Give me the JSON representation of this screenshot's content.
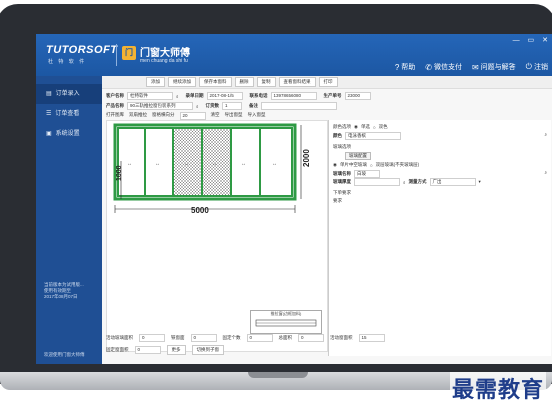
{
  "header": {
    "brand_main": "TUTORSOFT",
    "brand_sub": "杜 特 软 件",
    "product_icon": "门",
    "product_name": "门窗大师傅",
    "product_sub": "men chuang da shi fu",
    "window_controls": [
      "—",
      "▭",
      "✕"
    ],
    "links": [
      {
        "icon": "help-icon",
        "glyph": "?",
        "label": "帮助"
      },
      {
        "icon": "wechat-icon",
        "glyph": "✆",
        "label": "微信支付"
      },
      {
        "icon": "feedback-icon",
        "glyph": "✉",
        "label": "问题与解答"
      },
      {
        "icon": "logout-icon",
        "glyph": "⏻",
        "label": "注销"
      }
    ]
  },
  "sidebar": {
    "items": [
      {
        "label": "订单录入",
        "icon": "document-icon",
        "glyph": "▤",
        "active": true
      },
      {
        "label": "订单查看",
        "icon": "list-icon",
        "glyph": "☰",
        "active": false
      },
      {
        "label": "系统设置",
        "icon": "settings-icon",
        "glyph": "▣",
        "active": false
      }
    ],
    "footer_lines": [
      "当前版本为试用版...",
      "使用有效期至",
      "2017年08月07日"
    ],
    "bottom_text": "欢迎使用门窗大师傅"
  },
  "toolbar": {
    "buttons": [
      "添加",
      "继续添加",
      "保存本窗料",
      "删除",
      "复制",
      "查看窗料结果",
      "打印"
    ]
  },
  "form": {
    "customer_label": "客户名称",
    "customer_value": "杜特软件",
    "date_label": "录单日期",
    "date_value": "2017-08-1/5",
    "phone_label": "联系电话",
    "phone_value": "13978656080",
    "order_label": "生产单号",
    "order_value": "23000",
    "product_label": "产品名称",
    "product_value": "90三轨推拉窗包装系列",
    "qty_label": "订货数",
    "qty_value": "1",
    "note_label": "备注",
    "note_value": ""
  },
  "sub_toolbar": [
    "打开图库",
    "双扇推拉",
    "窗格横向分",
    "20",
    "清空",
    "导出窗型",
    "导入窗型"
  ],
  "drawing": {
    "width_label": "5000",
    "height_label": "2000",
    "sash_height_label": "1000"
  },
  "right_panel": {
    "row1_label": "颜色选项",
    "row1_opt_a": "单选",
    "row1_opt_b": "双色",
    "color_label": "颜色",
    "color_value": "电泳香槟",
    "glass_section": "玻璃选项",
    "glass_btn": "玻璃配置",
    "glass_opt_a": "单片中空玻璃",
    "glass_opt_b": "双层玻璃(不夹玻璃层)",
    "glass_name_label": "玻璃名称",
    "glass_name_value": "白玻",
    "glass_thick_label": "玻璃厚度",
    "glass_thick_value": "",
    "measure_label": "测量方式",
    "measure_value": "广出",
    "misc_label": "下单要求",
    "misc_value": "要求"
  },
  "legend_box": {
    "title": "推拉窗(边框加料)"
  },
  "bottom": {
    "row1": [
      {
        "label": "活动玻璃面积",
        "value": "0"
      },
      {
        "label": "铁窗面",
        "value": "0"
      },
      {
        "label": "固定个数",
        "value": "0"
      },
      {
        "label": "总面积",
        "value": "0"
      },
      {
        "label": "活动窗面积",
        "value": "15"
      }
    ],
    "row2_label": "固定窗面积",
    "row2_value": "0",
    "btn_more": "更多",
    "btn_show": "切换到子窗"
  },
  "watermark": "最需教育",
  "colors": {
    "header": "#1f5cab",
    "sidebar": "#1f4f94",
    "frame": "#2e9a44"
  }
}
